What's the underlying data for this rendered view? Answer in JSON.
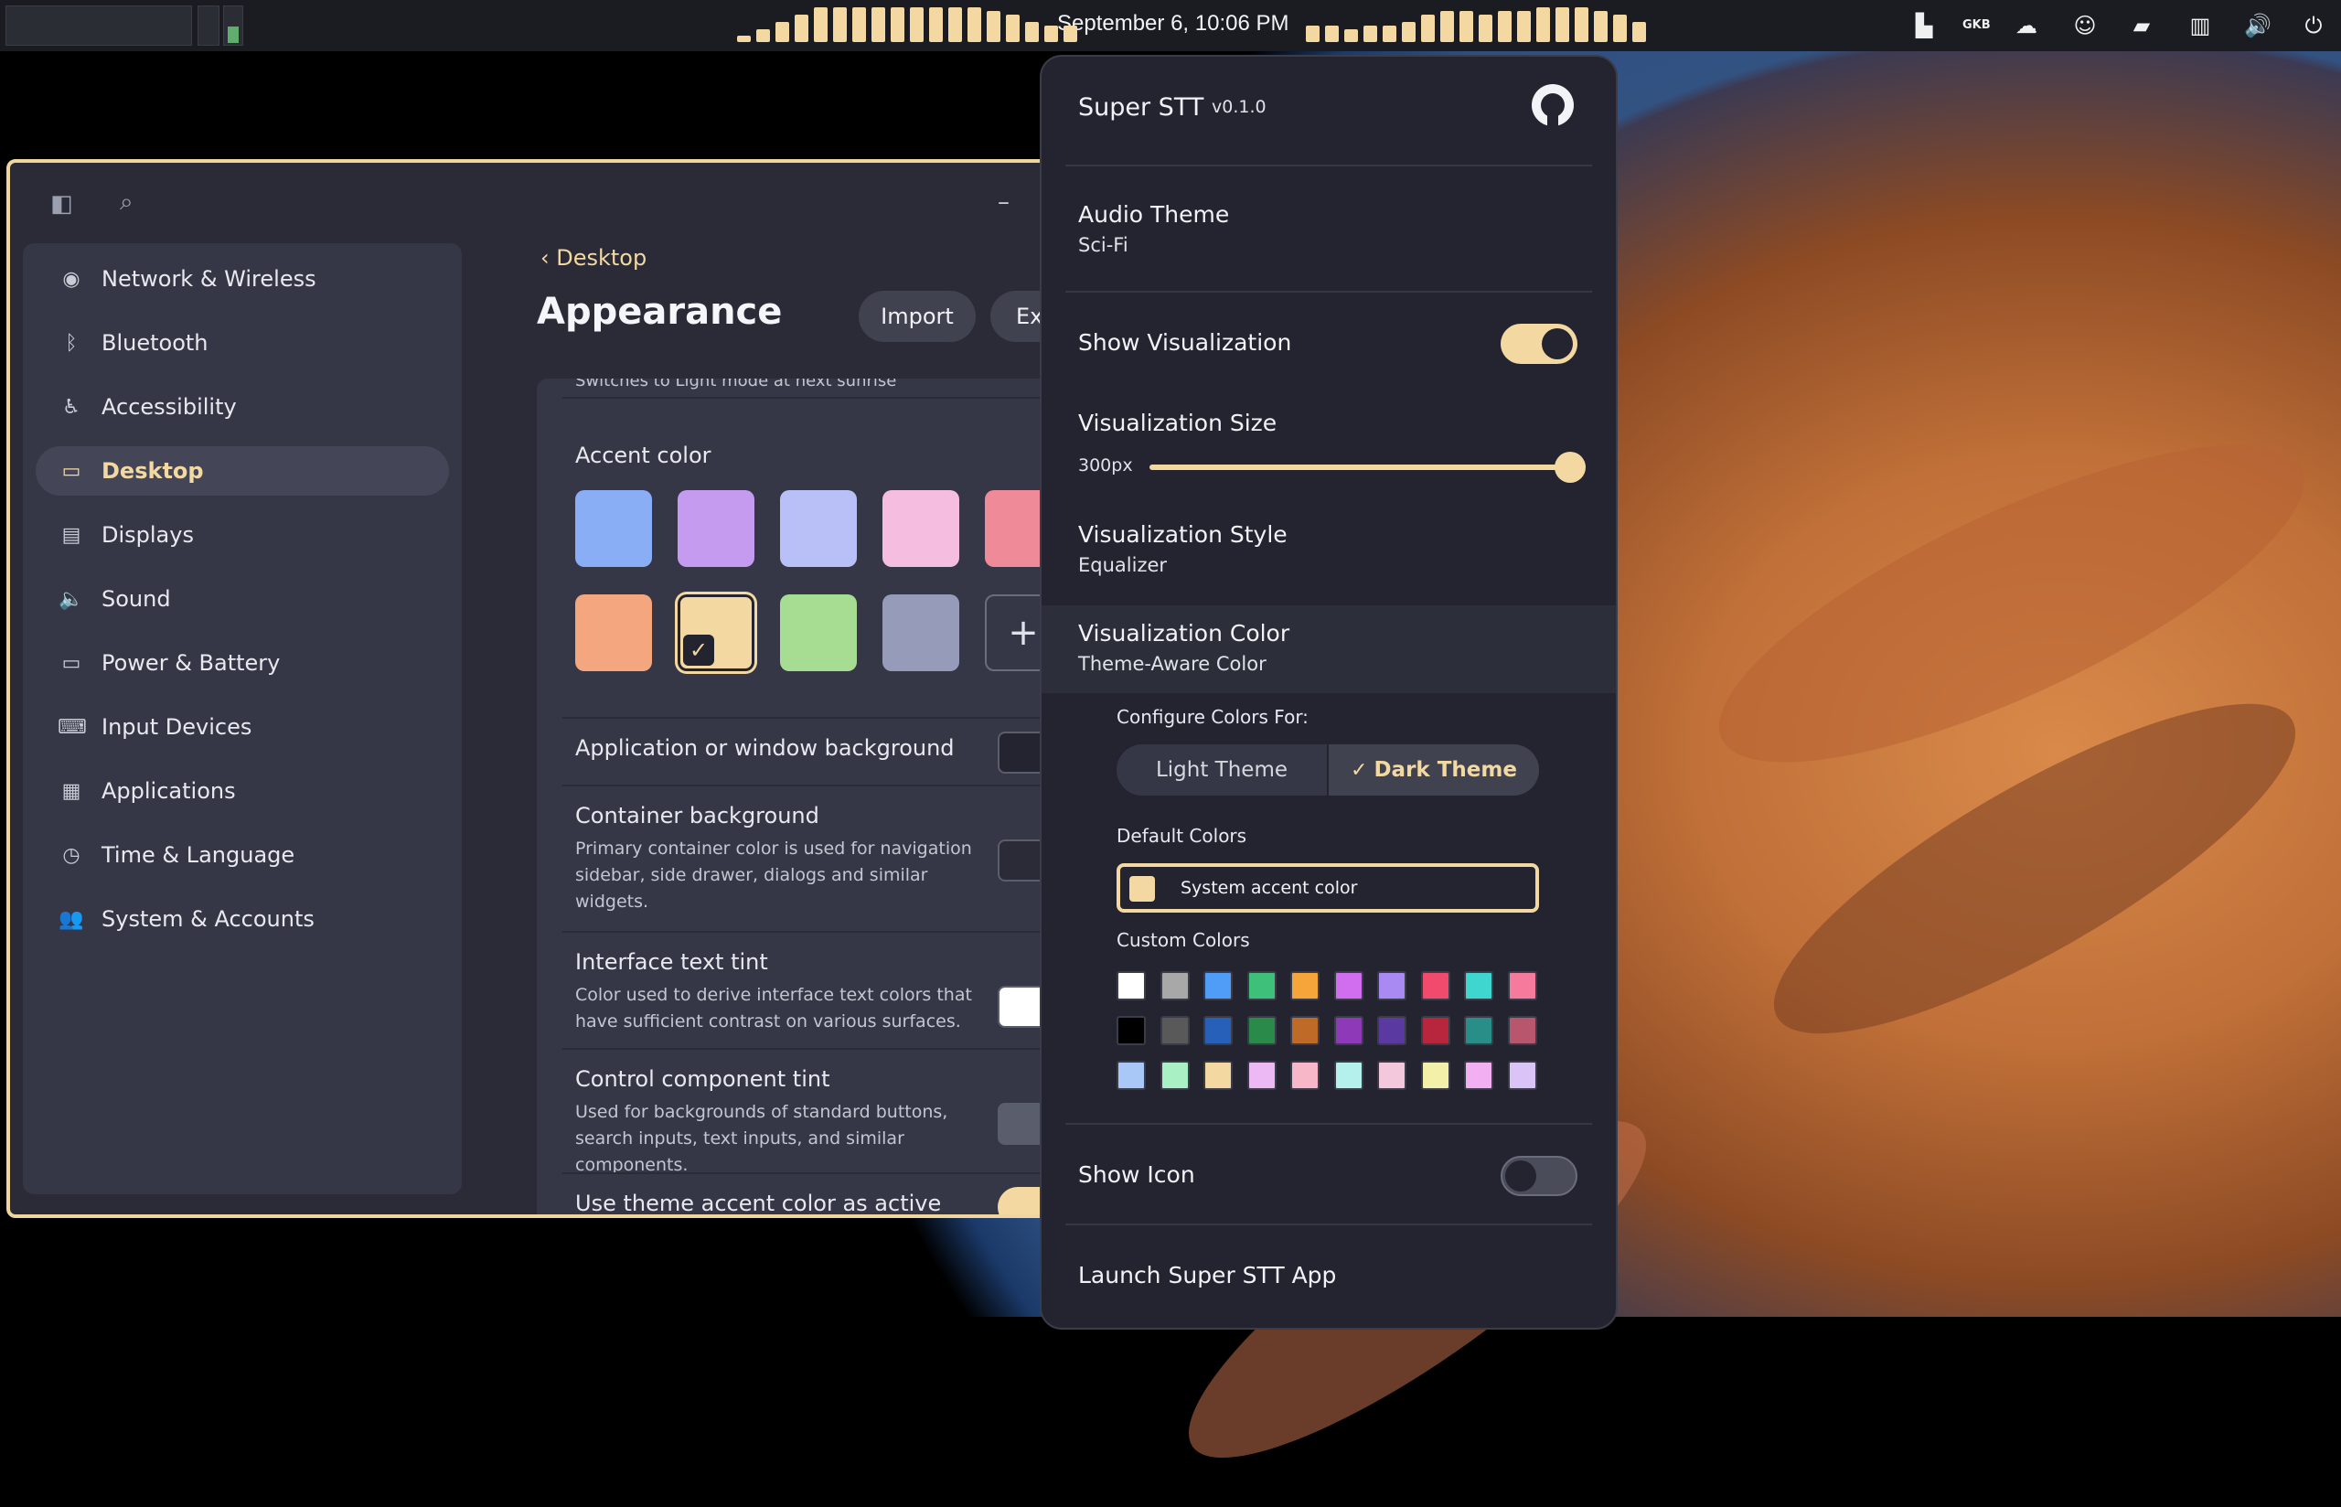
{
  "panel": {
    "clock": "September 6, 10:06 PM",
    "accent_color": "#f3d8a2",
    "tray_icons": [
      "tiling-icon",
      "keyboard-layout-icon",
      "cloud-icon",
      "emoji-icon",
      "chat-icon",
      "window-layout-icon",
      "volume-icon",
      "power-icon"
    ],
    "keyboard_layout_label": "GKB"
  },
  "settings": {
    "sidebar_items": [
      {
        "label": "Network & Wireless",
        "icon": "wifi-icon",
        "glyph": "◉"
      },
      {
        "label": "Bluetooth",
        "icon": "bluetooth-icon",
        "glyph": "ᛒ"
      },
      {
        "label": "Accessibility",
        "icon": "accessibility-icon",
        "glyph": "♿"
      },
      {
        "label": "Desktop",
        "icon": "desktop-icon",
        "glyph": "▭"
      },
      {
        "label": "Displays",
        "icon": "display-icon",
        "glyph": "▤"
      },
      {
        "label": "Sound",
        "icon": "speaker-icon",
        "glyph": "🔈"
      },
      {
        "label": "Power & Battery",
        "icon": "battery-icon",
        "glyph": "▭"
      },
      {
        "label": "Input Devices",
        "icon": "keyboard-icon",
        "glyph": "⌨"
      },
      {
        "label": "Applications",
        "icon": "apps-grid-icon",
        "glyph": "▦"
      },
      {
        "label": "Time & Language",
        "icon": "clock-globe-icon",
        "glyph": "◷"
      },
      {
        "label": "System & Accounts",
        "icon": "users-icon",
        "glyph": "👥"
      }
    ],
    "active_item": "Desktop",
    "breadcrumb": "Desktop",
    "page_title": "Appearance",
    "import_label": "Import",
    "export_label": "Exp",
    "cut_off_text": "Switches to Light mode at next sunrise",
    "accent_color_label": "Accent color",
    "accent_swatches_row1": [
      "#8aaef5",
      "#c59bf0",
      "#b9c0f7",
      "#f5bde0",
      "#ef8b98"
    ],
    "accent_swatches_row2": [
      "#f4a77f",
      "#f3d8a2",
      "#a6dd93",
      "#959bb8"
    ],
    "selected_accent": "#f3d8a2",
    "add_label": "+",
    "settings_rows": [
      {
        "title": "Application or window background",
        "desc": ""
      },
      {
        "title": "Container background",
        "desc": "Primary container color is used for navigation sidebar, side drawer, dialogs and similar widgets."
      },
      {
        "title": "Interface text tint",
        "desc": "Color used to derive interface text colors that have sufficient contrast on various surfaces."
      },
      {
        "title": "Control component tint",
        "desc": "Used for backgrounds of standard buttons, search inputs, text inputs, and similar components."
      },
      {
        "title": "Use theme accent color as active",
        "desc": ""
      }
    ]
  },
  "applet": {
    "app_name": "Super STT",
    "version": "v0.1.0",
    "github_icon": "github-icon",
    "audio_theme_label": "Audio Theme",
    "audio_theme_value": "Sci-Fi",
    "show_visualization_label": "Show Visualization",
    "show_visualization_on": true,
    "viz_size_label": "Visualization Size",
    "viz_size_value": "300px",
    "viz_size_fraction": 1.0,
    "viz_style_label": "Visualization Style",
    "viz_style_value": "Equalizer",
    "viz_color_label": "Visualization Color",
    "viz_color_value": "Theme-Aware Color",
    "configure_label": "Configure Colors For:",
    "light_theme_label": "Light Theme",
    "dark_theme_label": "Dark Theme",
    "selected_theme": "Dark Theme",
    "default_colors_label": "Default Colors",
    "system_accent_label": "System accent color",
    "custom_colors_label": "Custom Colors",
    "custom_colors": [
      [
        "#ffffff",
        "#a8a8a8",
        "#4f9df7",
        "#3ec07a",
        "#f6a53a",
        "#d16ef0",
        "#a98af2",
        "#f04b6c",
        "#3ed6cf",
        "#f57a9b"
      ],
      [
        "#000000",
        "#595959",
        "#2660b8",
        "#2a8a4a",
        "#c06a28",
        "#8e3ab8",
        "#5a3aa0",
        "#b8263e",
        "#2a8e88",
        "#b8566e"
      ],
      [
        "#a9c8f7",
        "#a9f0c4",
        "#f3d8a2",
        "#ecb9f5",
        "#f7b7c9",
        "#b6f0ec",
        "#f3c8dc",
        "#f3f0a9",
        "#f2b0f2",
        "#d9c3f7"
      ]
    ],
    "show_icon_label": "Show Icon",
    "show_icon_on": false,
    "launch_label": "Launch Super STT App"
  }
}
